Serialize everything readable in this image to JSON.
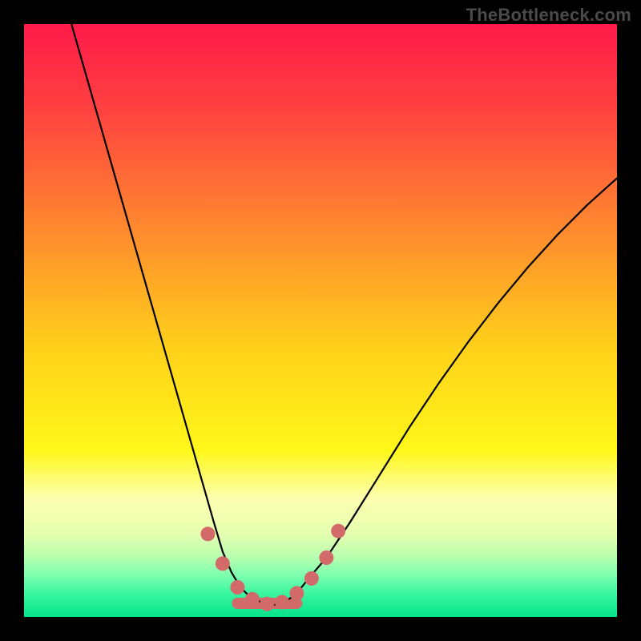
{
  "watermark": "TheBottleneck.com",
  "chart_data": {
    "type": "line",
    "title": "",
    "xlabel": "",
    "ylabel": "",
    "xlim": [
      0,
      100
    ],
    "ylim": [
      0,
      100
    ],
    "grid": false,
    "legend": false,
    "gradient_stops": [
      {
        "offset": 0.0,
        "color": "#ff1a49"
      },
      {
        "offset": 0.15,
        "color": "#ff4340"
      },
      {
        "offset": 0.35,
        "color": "#ff8b2e"
      },
      {
        "offset": 0.55,
        "color": "#ffd21a"
      },
      {
        "offset": 0.72,
        "color": "#fff71a"
      },
      {
        "offset": 0.8,
        "color": "#fdffb0"
      },
      {
        "offset": 0.86,
        "color": "#e5ffb0"
      },
      {
        "offset": 0.9,
        "color": "#b7ffb0"
      },
      {
        "offset": 0.93,
        "color": "#7cffae"
      },
      {
        "offset": 0.96,
        "color": "#3af7a0"
      },
      {
        "offset": 1.0,
        "color": "#06e38b"
      }
    ],
    "series": [
      {
        "name": "bottleneck-curve",
        "color": "#000000",
        "x": [
          8,
          10,
          12,
          14,
          16,
          18,
          20,
          22,
          24,
          26,
          28,
          30,
          32,
          33.5,
          35,
          36.5,
          38,
          40,
          42,
          44,
          46,
          48,
          51,
          55,
          60,
          65,
          70,
          75,
          80,
          85,
          90,
          95,
          100
        ],
        "y": [
          100,
          93,
          86,
          79,
          72,
          65,
          58,
          51,
          44,
          37,
          30,
          23,
          16,
          11,
          7.5,
          5,
          3.5,
          2.5,
          2,
          2.5,
          4,
          6.5,
          10,
          16,
          24,
          32,
          39.5,
          46.5,
          53,
          59,
          64.5,
          69.5,
          74
        ]
      }
    ],
    "markers": {
      "name": "highlight-points",
      "color": "#d26a6a",
      "radius": 9,
      "x": [
        31,
        33.5,
        36,
        38.5,
        41,
        43.5,
        46,
        48.5,
        51,
        53
      ],
      "y": [
        14,
        9,
        5,
        3,
        2.2,
        2.5,
        4,
        6.5,
        10,
        14.5
      ]
    },
    "trough_band": {
      "name": "trough-band",
      "color": "#d26a6a",
      "x_start": 36,
      "x_end": 46,
      "y": 2.3,
      "thickness": 14
    }
  }
}
